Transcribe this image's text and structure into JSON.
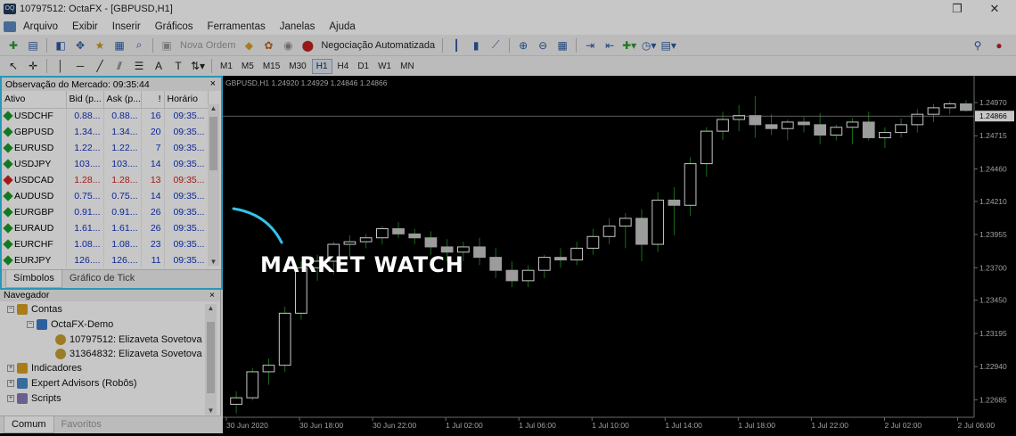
{
  "window": {
    "title": "10797512: OctaFX - [GBPUSD,H1]",
    "app_icon_label": "OQ"
  },
  "menu": [
    "Arquivo",
    "Exibir",
    "Inserir",
    "Gráficos",
    "Ferramentas",
    "Janelas",
    "Ajuda"
  ],
  "toolbar": {
    "new_order": "Nova Ordem",
    "auto_trading": "Negociação Automatizada"
  },
  "timeframes": [
    "M1",
    "M5",
    "M15",
    "M30",
    "H1",
    "H4",
    "D1",
    "W1",
    "MN"
  ],
  "timeframe_selected": "H1",
  "market_watch": {
    "header": "Observação do Mercado: 09:35:44",
    "columns": [
      "Ativo",
      "Bid (p...",
      "Ask (p...",
      "!",
      "Horário"
    ],
    "rows": [
      {
        "symbol": "USDCHF",
        "bid": "0.88...",
        "ask": "0.88...",
        "spread": "16",
        "time": "09:35...",
        "dir": "up"
      },
      {
        "symbol": "GBPUSD",
        "bid": "1.34...",
        "ask": "1.34...",
        "spread": "20",
        "time": "09:35...",
        "dir": "up"
      },
      {
        "symbol": "EURUSD",
        "bid": "1.22...",
        "ask": "1.22...",
        "spread": "7",
        "time": "09:35...",
        "dir": "up"
      },
      {
        "symbol": "USDJPY",
        "bid": "103....",
        "ask": "103....",
        "spread": "14",
        "time": "09:35...",
        "dir": "up"
      },
      {
        "symbol": "USDCAD",
        "bid": "1.28...",
        "ask": "1.28...",
        "spread": "13",
        "time": "09:35...",
        "dir": "down"
      },
      {
        "symbol": "AUDUSD",
        "bid": "0.75...",
        "ask": "0.75...",
        "spread": "14",
        "time": "09:35...",
        "dir": "up"
      },
      {
        "symbol": "EURGBP",
        "bid": "0.91...",
        "ask": "0.91...",
        "spread": "26",
        "time": "09:35...",
        "dir": "up"
      },
      {
        "symbol": "EURAUD",
        "bid": "1.61...",
        "ask": "1.61...",
        "spread": "26",
        "time": "09:35...",
        "dir": "up"
      },
      {
        "symbol": "EURCHF",
        "bid": "1.08...",
        "ask": "1.08...",
        "spread": "23",
        "time": "09:35...",
        "dir": "up"
      },
      {
        "symbol": "EURJPY",
        "bid": "126....",
        "ask": "126....",
        "spread": "11",
        "time": "09:35...",
        "dir": "up"
      }
    ],
    "tabs": [
      "Símbolos",
      "Gráfico de Tick"
    ]
  },
  "navigator": {
    "header": "Navegador",
    "accounts": "Contas",
    "server": "OctaFX-Demo",
    "account1": "10797512: Elizaveta Sovetova",
    "account2": "31364832: Elizaveta Sovetova",
    "indicators": "Indicadores",
    "experts": "Expert Advisors (Robôs)",
    "scripts": "Scripts",
    "tabs": [
      "Comum",
      "Favoritos"
    ]
  },
  "chart_data": {
    "type": "candlestick",
    "header": "GBPUSD,H1  1.24920 1.24929 1.24846 1.24866",
    "current_price": "1.24866",
    "y_ticks": [
      "1.24970",
      "1.24715",
      "1.24460",
      "1.24210",
      "1.23955",
      "1.23700",
      "1.23450",
      "1.23195",
      "1.22940",
      "1.22685"
    ],
    "x_ticks": [
      "30 Jun 2020",
      "30 Jun 18:00",
      "30 Jun 22:00",
      "1 Jul 02:00",
      "1 Jul 06:00",
      "1 Jul 10:00",
      "1 Jul 14:00",
      "1 Jul 18:00",
      "1 Jul 22:00",
      "2 Jul 02:00",
      "2 Jul 06:00"
    ],
    "ylim": [
      1.2255,
      1.2508
    ],
    "candles": [
      [
        1.2265,
        1.2275,
        1.2258,
        1.227
      ],
      [
        1.227,
        1.2293,
        1.2268,
        1.229
      ],
      [
        1.229,
        1.23,
        1.228,
        1.2295
      ],
      [
        1.2295,
        1.234,
        1.229,
        1.2335
      ],
      [
        1.2335,
        1.2375,
        1.233,
        1.237
      ],
      [
        1.237,
        1.238,
        1.236,
        1.2375
      ],
      [
        1.2375,
        1.239,
        1.2365,
        1.2388
      ],
      [
        1.2388,
        1.2395,
        1.2378,
        1.239
      ],
      [
        1.239,
        1.2396,
        1.2385,
        1.2393
      ],
      [
        1.2393,
        1.2402,
        1.2388,
        1.24
      ],
      [
        1.24,
        1.2405,
        1.2393,
        1.2396
      ],
      [
        1.2396,
        1.24,
        1.2388,
        1.2393
      ],
      [
        1.2393,
        1.2398,
        1.238,
        1.2386
      ],
      [
        1.2386,
        1.2392,
        1.2375,
        1.2382
      ],
      [
        1.2382,
        1.239,
        1.2375,
        1.2386
      ],
      [
        1.2386,
        1.2393,
        1.2372,
        1.2378
      ],
      [
        1.2378,
        1.2385,
        1.2362,
        1.2368
      ],
      [
        1.2368,
        1.2375,
        1.2355,
        1.236
      ],
      [
        1.236,
        1.2372,
        1.2355,
        1.2368
      ],
      [
        1.2368,
        1.238,
        1.2362,
        1.2378
      ],
      [
        1.2378,
        1.2385,
        1.237,
        1.2376
      ],
      [
        1.2376,
        1.239,
        1.2372,
        1.2385
      ],
      [
        1.2385,
        1.24,
        1.238,
        1.2394
      ],
      [
        1.2394,
        1.2408,
        1.2388,
        1.2402
      ],
      [
        1.2402,
        1.2412,
        1.2385,
        1.2408
      ],
      [
        1.2408,
        1.2415,
        1.2375,
        1.2388
      ],
      [
        1.2388,
        1.2428,
        1.2382,
        1.2422
      ],
      [
        1.2422,
        1.2432,
        1.2395,
        1.2418
      ],
      [
        1.2418,
        1.2455,
        1.241,
        1.245
      ],
      [
        1.245,
        1.2478,
        1.244,
        1.2475
      ],
      [
        1.2475,
        1.249,
        1.2468,
        1.2484
      ],
      [
        1.2484,
        1.2495,
        1.2475,
        1.2487
      ],
      [
        1.2487,
        1.2502,
        1.247,
        1.248
      ],
      [
        1.248,
        1.2488,
        1.2472,
        1.2477
      ],
      [
        1.2477,
        1.2484,
        1.2468,
        1.2482
      ],
      [
        1.2482,
        1.2486,
        1.2474,
        1.248
      ],
      [
        1.248,
        1.2489,
        1.2465,
        1.2472
      ],
      [
        1.2472,
        1.248,
        1.2468,
        1.2478
      ],
      [
        1.2478,
        1.2485,
        1.2465,
        1.2482
      ],
      [
        1.2482,
        1.249,
        1.2468,
        1.247
      ],
      [
        1.247,
        1.2478,
        1.2462,
        1.2474
      ],
      [
        1.2474,
        1.2485,
        1.247,
        1.248
      ],
      [
        1.248,
        1.2492,
        1.2474,
        1.2488
      ],
      [
        1.2488,
        1.2496,
        1.2482,
        1.2493
      ],
      [
        1.2493,
        1.2498,
        1.2488,
        1.2496
      ],
      [
        1.2496,
        1.2499,
        1.249,
        1.2491
      ]
    ]
  },
  "annotation": "MARKET WATCH",
  "colors": {
    "accent": "#33c3e8",
    "bull": "#ffffff",
    "bear": "#c8c8c8",
    "wick": "#1f8a1f",
    "grid": "#1e1e1e"
  }
}
